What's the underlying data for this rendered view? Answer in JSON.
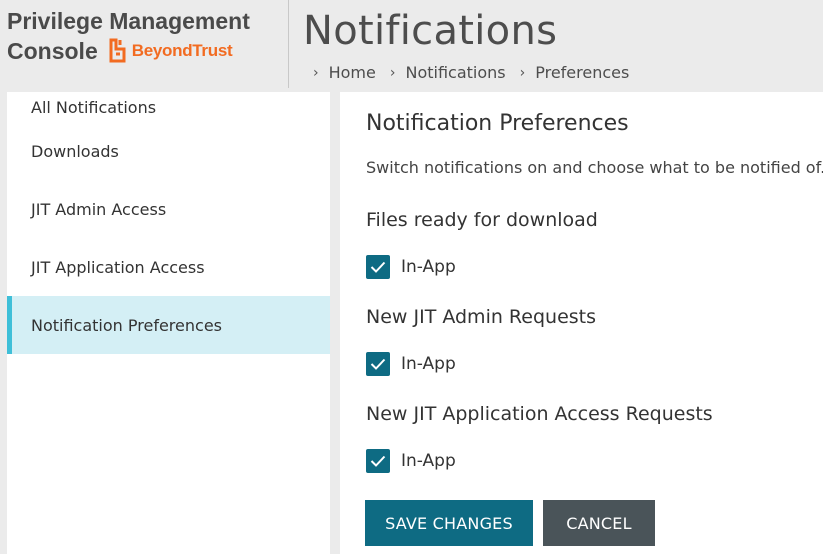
{
  "app": {
    "title_line1": "Privilege Management",
    "title_line2": "Console",
    "logo_text": "BeyondTrust",
    "logo_color": "#f26b21"
  },
  "header": {
    "page_title": "Notifications",
    "breadcrumb": [
      "Home",
      "Notifications",
      "Preferences"
    ],
    "breadcrumb_separator_icon": "chevron-right-icon"
  },
  "sidebar": {
    "items": [
      {
        "label": "All Notifications",
        "active": false
      },
      {
        "label": "Downloads",
        "active": false
      },
      {
        "label": "JIT Admin Access",
        "active": false
      },
      {
        "label": "JIT Application Access",
        "active": false
      },
      {
        "label": "Notification Preferences",
        "active": true
      }
    ],
    "active_color": "#d4eff5",
    "active_accent": "#3fbfd8"
  },
  "main": {
    "heading": "Notification Preferences",
    "subtitle": "Switch notifications on and choose what to be notified of.",
    "sections": [
      {
        "heading": "Files ready for download",
        "option_label": "In-App",
        "checked": true
      },
      {
        "heading": "New JIT Admin Requests",
        "option_label": "In-App",
        "checked": true
      },
      {
        "heading": "New JIT Application Access Requests",
        "option_label": "In-App",
        "checked": true
      }
    ],
    "checkbox_color": "#0e6b83",
    "save_label": "SAVE CHANGES",
    "cancel_label": "CANCEL",
    "save_color": "#0e6b83",
    "cancel_color": "#4a5459"
  }
}
